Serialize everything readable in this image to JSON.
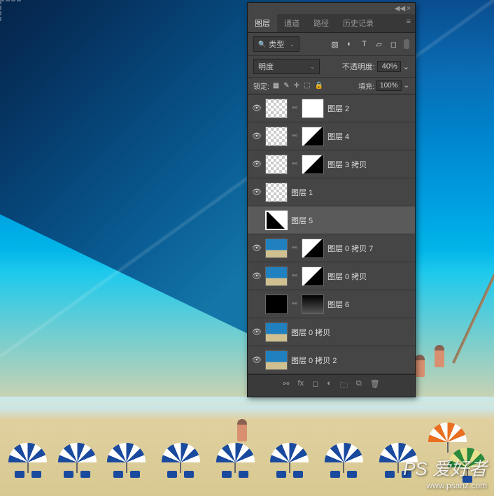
{
  "tabs": {
    "layers": "图层",
    "channels": "通道",
    "paths": "路径",
    "history": "历史记录"
  },
  "filter": {
    "label": "类型"
  },
  "blend": {
    "mode": "明度",
    "opacity_label": "不透明度:",
    "opacity_value": "40%"
  },
  "lock": {
    "label": "锁定:",
    "fill_label": "填充:",
    "fill_value": "100%"
  },
  "layers_list": [
    {
      "name": "图层 2",
      "vis": true,
      "thumb": "checker",
      "mask": "white",
      "link": true
    },
    {
      "name": "图层 4",
      "vis": true,
      "thumb": "checker",
      "mask": "diag",
      "link": true
    },
    {
      "name": "图层 3 拷贝",
      "vis": true,
      "thumb": "checker",
      "mask": "diag",
      "link": true
    },
    {
      "name": "图层 1",
      "vis": true,
      "thumb": "checker"
    },
    {
      "name": "图层 5",
      "vis": false,
      "thumb": "diag2",
      "selected": true
    },
    {
      "name": "图层 0 拷贝 7",
      "vis": true,
      "thumb": "beach-thumb",
      "mask": "diag",
      "link": true
    },
    {
      "name": "图层 0 拷贝",
      "vis": true,
      "thumb": "beach-thumb",
      "mask": "diag",
      "link": true
    },
    {
      "name": "图层 6",
      "vis": false,
      "thumb": "black",
      "mask": "grad",
      "link": true
    },
    {
      "name": "图层 0 拷贝",
      "vis": true,
      "thumb": "beach-thumb"
    },
    {
      "name": "图层 0 拷贝 2",
      "vis": true,
      "thumb": "beach-thumb"
    }
  ],
  "watermark": {
    "brand": "PS 爱好者",
    "url": "www.psahz.com"
  }
}
